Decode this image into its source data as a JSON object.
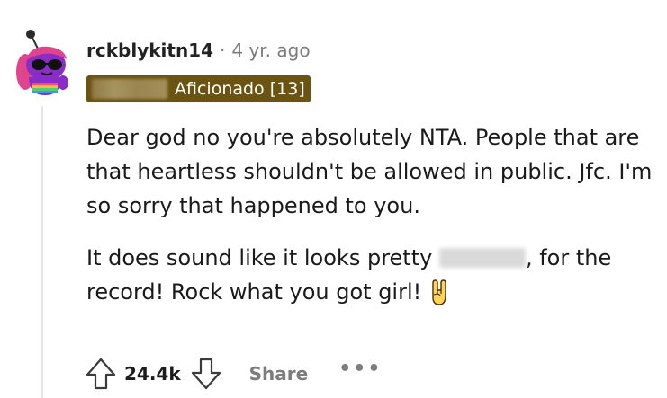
{
  "comment": {
    "author": "rckblykitn14",
    "separator": "·",
    "age": "4 yr. ago",
    "flair_label": "Aficionado [13]",
    "paragraphs": [
      {
        "text": "Dear god no you're absolutely NTA. People that are that heartless shouldn't be allowed in public. Jfc. I'm so sorry that happened to you."
      },
      {
        "text_before": "It does sound like it looks pretty ",
        "text_after": ", for the record! Rock what you got girl!"
      }
    ],
    "emoji": "rock-on-hand-emoji"
  },
  "actions": {
    "score": "24.4k",
    "share_label": "Share",
    "more_label": "•••"
  },
  "colors": {
    "flair_bg": "#6b5412",
    "meta_text": "#7c7c7c",
    "avatar_purple": "#8a2cc7"
  }
}
